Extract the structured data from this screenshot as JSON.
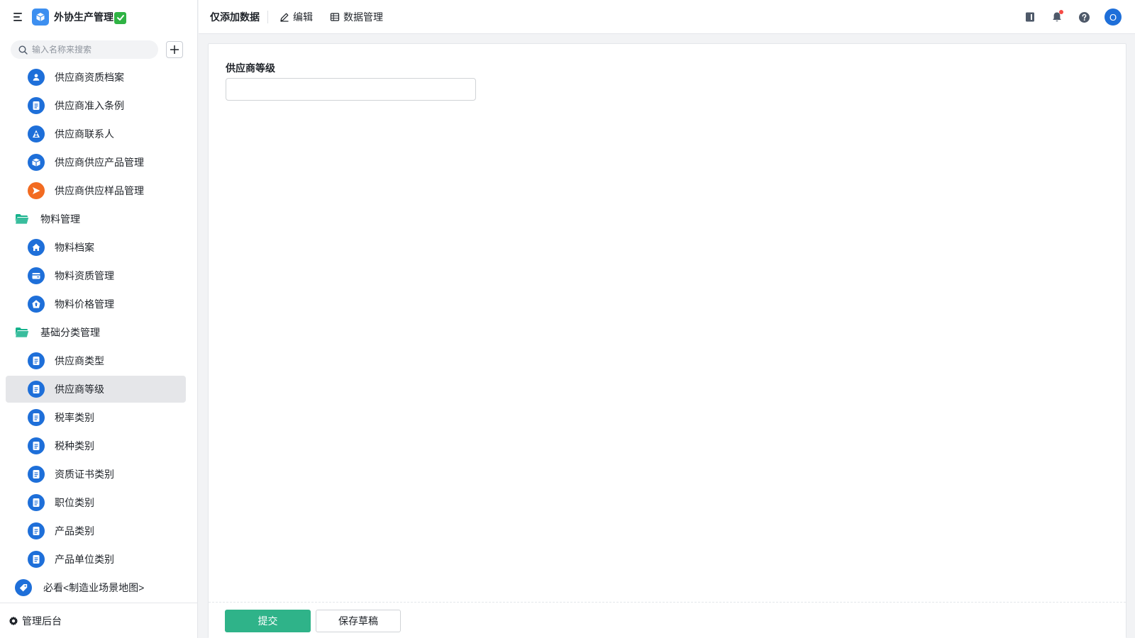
{
  "app": {
    "title": "外协生产管理",
    "accent": "#3d8ff0"
  },
  "sidebar": {
    "search_placeholder": "输入名称来搜索",
    "items": [
      {
        "type": "child",
        "label": "供应商资质档案",
        "icon": "user-card-icon",
        "color": "#1e6fd9"
      },
      {
        "type": "child",
        "label": "供应商准入条例",
        "icon": "document-icon",
        "color": "#1e6fd9"
      },
      {
        "type": "child",
        "label": "供应商联系人",
        "icon": "contact-icon",
        "color": "#1e6fd9"
      },
      {
        "type": "child",
        "label": "供应商供应产品管理",
        "icon": "box-icon",
        "color": "#1e6fd9"
      },
      {
        "type": "child",
        "label": "供应商供应样品管理",
        "icon": "send-icon",
        "color": "#f26b21"
      },
      {
        "type": "group",
        "label": "物料管理",
        "icon": "folder-icon",
        "color": "#16b28c"
      },
      {
        "type": "child",
        "label": "物料档案",
        "icon": "home-icon",
        "color": "#1e6fd9"
      },
      {
        "type": "child",
        "label": "物料资质管理",
        "icon": "wallet-icon",
        "color": "#1e6fd9"
      },
      {
        "type": "child",
        "label": "物料价格管理",
        "icon": "price-tag-icon",
        "color": "#1e6fd9"
      },
      {
        "type": "group",
        "label": "基础分类管理",
        "icon": "folder-icon",
        "color": "#16b28c"
      },
      {
        "type": "child",
        "label": "供应商类型",
        "icon": "document-icon",
        "color": "#1e6fd9"
      },
      {
        "type": "child",
        "label": "供应商等级",
        "icon": "document-icon",
        "color": "#1e6fd9",
        "active": true
      },
      {
        "type": "child",
        "label": "税率类别",
        "icon": "document-icon",
        "color": "#1e6fd9"
      },
      {
        "type": "child",
        "label": "税种类别",
        "icon": "document-icon",
        "color": "#1e6fd9"
      },
      {
        "type": "child",
        "label": "资质证书类别",
        "icon": "document-icon",
        "color": "#1e6fd9"
      },
      {
        "type": "child",
        "label": "职位类别",
        "icon": "document-icon",
        "color": "#1e6fd9"
      },
      {
        "type": "child",
        "label": "产品类别",
        "icon": "document-icon",
        "color": "#1e6fd9"
      },
      {
        "type": "child",
        "label": "产品单位类别",
        "icon": "document-icon",
        "color": "#1e6fd9"
      },
      {
        "type": "group-link",
        "label": "必看<制造业场景地图>",
        "icon": "map-tag-icon",
        "color": "#1e6fd9"
      }
    ],
    "admin_label": "管理后台"
  },
  "topbar": {
    "title": "仅添加数据",
    "edit_label": "编辑",
    "data_manage_label": "数据管理",
    "avatar_initial": "O"
  },
  "form": {
    "field_label": "供应商等级",
    "field_value": "",
    "submit_label": "提交",
    "draft_label": "保存草稿",
    "submit_color": "#2fb389"
  }
}
